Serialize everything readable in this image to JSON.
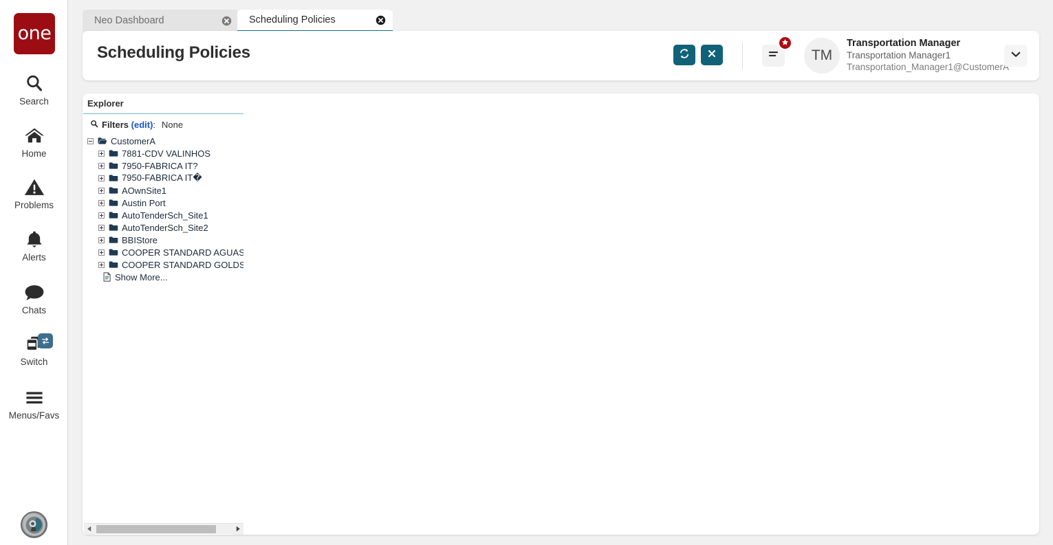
{
  "colors": {
    "brand_red": "#9b0d13",
    "teal_button": "#116278",
    "badge_red": "#ae0b13",
    "switch_badge_blue": "#3d6e8e",
    "active_tab_underline": "#156f82",
    "link_blue": "#1155cc",
    "panel_underline": "#6fb9cd",
    "page_background": "#f1f1f1"
  },
  "sidebar": {
    "logo_text": "one",
    "items": [
      {
        "label": "Search",
        "icon": "search-icon"
      },
      {
        "label": "Home",
        "icon": "home-icon"
      },
      {
        "label": "Problems",
        "icon": "warning-triangle-icon"
      },
      {
        "label": "Alerts",
        "icon": "bell-icon"
      },
      {
        "label": "Chats",
        "icon": "chat-bubble-icon"
      },
      {
        "label": "Switch",
        "icon": "windows-stack-icon",
        "badge_icon": "swap-arrows-icon"
      },
      {
        "label": "Menus/Favs",
        "icon": "hamburger-icon"
      }
    ],
    "bottom_avatar_icon": "assistant-avatar-icon"
  },
  "tabs": [
    {
      "label": "Neo Dashboard",
      "active": false,
      "close_icon": "close-circle-icon"
    },
    {
      "label": "Scheduling Policies",
      "active": true,
      "close_icon": "close-circle-icon"
    }
  ],
  "header": {
    "title": "Scheduling Policies",
    "refresh_icon": "refresh-icon",
    "close_icon": "x-icon",
    "menu_icon": "hamburger-menu-icon",
    "menu_badge_icon": "star-icon",
    "avatar_initials": "TM",
    "user_role": "Transportation Manager",
    "user_name": "Transportation Manager1",
    "user_email": "Transportation_Manager1@CustomerA",
    "chevron_icon": "chevron-down-icon"
  },
  "explorer": {
    "panel_title": "Explorer",
    "filters": {
      "search_icon": "magnifier-icon",
      "label": "Filters",
      "edit_link": "(edit)",
      "separator": ":",
      "value": "None"
    },
    "tree": {
      "root": {
        "label": "CustomerA",
        "expander": "minus",
        "icon": "open-folder-icon"
      },
      "children": [
        {
          "label": "7881-CDV VALINHOS",
          "expander": "plus",
          "icon": "folder-icon"
        },
        {
          "label": "7950-FABRICA IT?",
          "expander": "plus",
          "icon": "folder-icon"
        },
        {
          "label": "7950-FABRICA IT�",
          "expander": "plus",
          "icon": "folder-icon"
        },
        {
          "label": "AOwnSite1",
          "expander": "plus",
          "icon": "folder-icon"
        },
        {
          "label": "Austin Port",
          "expander": "plus",
          "icon": "folder-icon"
        },
        {
          "label": "AutoTenderSch_Site1",
          "expander": "plus",
          "icon": "folder-icon"
        },
        {
          "label": "AutoTenderSch_Site2",
          "expander": "plus",
          "icon": "folder-icon"
        },
        {
          "label": "BBIStore",
          "expander": "plus",
          "icon": "folder-icon"
        },
        {
          "label": "COOPER STANDARD AGUAS SEALING",
          "expander": "plus",
          "icon": "folder-icon"
        },
        {
          "label": "COOPER STANDARD GOLDSBORO",
          "expander": "plus",
          "icon": "folder-icon"
        }
      ],
      "show_more": {
        "label": "Show More...",
        "icon": "document-icon"
      }
    },
    "scrollbar": {
      "left_arrow_icon": "triangle-left-icon",
      "right_arrow_icon": "triangle-right-icon"
    }
  }
}
